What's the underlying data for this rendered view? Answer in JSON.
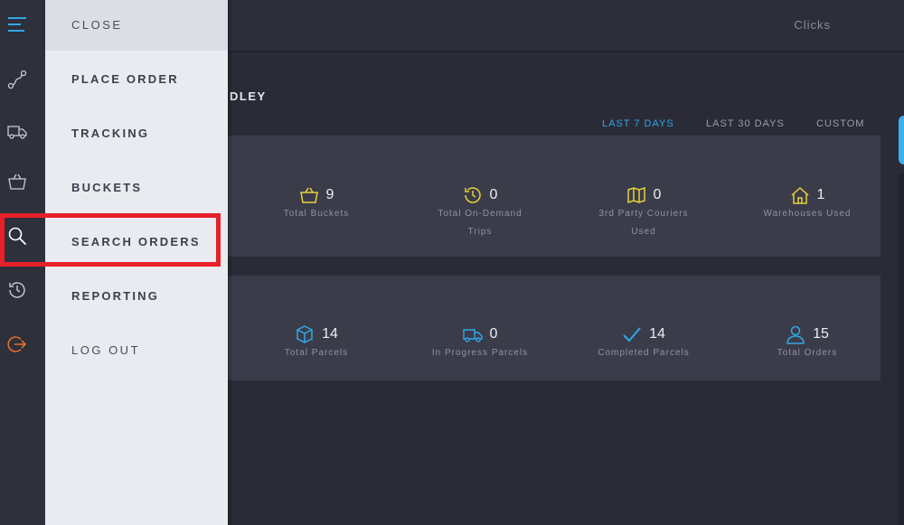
{
  "topbar": {
    "right_label": "Clicks"
  },
  "greeting": {
    "visible_text": "DLEY"
  },
  "range_tabs": [
    {
      "label": "LAST 7 DAYS",
      "active": true
    },
    {
      "label": "LAST 30 DAYS",
      "active": false
    },
    {
      "label": "CUSTOM",
      "active": false
    }
  ],
  "stats_row1": [
    {
      "value": "9",
      "label": "Total Buckets",
      "icon": "basket-icon"
    },
    {
      "value": "0",
      "label": "Total On-Demand Trips",
      "icon": "history-icon"
    },
    {
      "value": "0",
      "label": "3rd Party Couriers Used",
      "icon": "map-icon"
    },
    {
      "value": "1",
      "label": "Warehouses Used",
      "icon": "house-icon"
    }
  ],
  "stats_row2": [
    {
      "value": "14",
      "label": "Total Parcels",
      "icon": "box-icon"
    },
    {
      "value": "0",
      "label": "In Progress Parcels",
      "icon": "truck-icon"
    },
    {
      "value": "14",
      "label": "Completed Parcels",
      "icon": "check-icon"
    },
    {
      "value": "15",
      "label": "Total Orders",
      "icon": "user-icon"
    }
  ],
  "menu": {
    "items": [
      {
        "label": "CLOSE"
      },
      {
        "label": "PLACE ORDER"
      },
      {
        "label": "TRACKING"
      },
      {
        "label": "BUCKETS"
      },
      {
        "label": "SEARCH ORDERS"
      },
      {
        "label": "REPORTING"
      },
      {
        "label": "LOG OUT"
      }
    ]
  },
  "colors": {
    "accent_blue": "#2fa9e6",
    "accent_yellow": "#e6d23a",
    "logout_orange": "#e8702a",
    "highlight_red": "#e8202a"
  }
}
